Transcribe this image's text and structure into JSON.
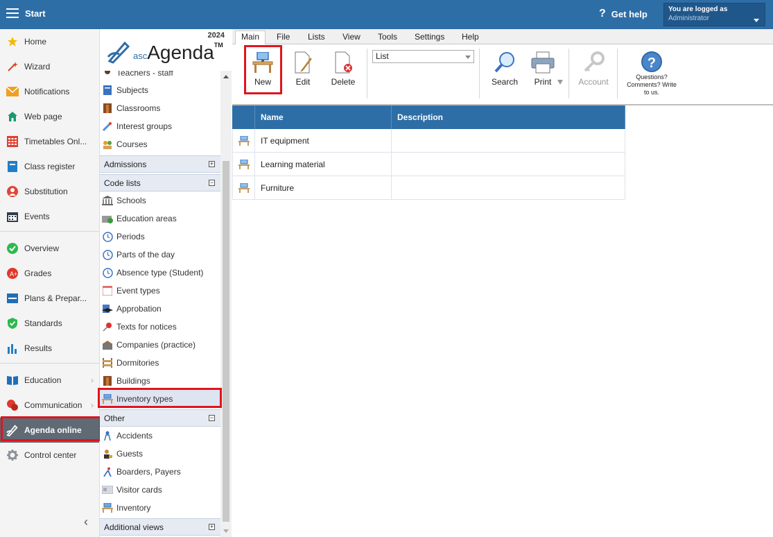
{
  "topbar": {
    "title": "Start",
    "help_label": "Get help",
    "help_glyph": "?",
    "login_line1": "You are logged as",
    "login_line2": "Administrator"
  },
  "leftnav": {
    "items": [
      {
        "label": "Home",
        "icon": "star-icon"
      },
      {
        "label": "Wizard",
        "icon": "wand-icon"
      },
      {
        "label": "Notifications",
        "icon": "envelope-icon"
      },
      {
        "label": "Web page",
        "icon": "house-icon"
      },
      {
        "label": "Timetables Onl...",
        "icon": "calendar-grid-icon"
      },
      {
        "label": "Class register",
        "icon": "book-icon"
      },
      {
        "label": "Substitution",
        "icon": "person-icon"
      },
      {
        "label": "Events",
        "icon": "event-calendar-icon"
      },
      {
        "label": "Overview",
        "icon": "check-circle-icon"
      },
      {
        "label": "Grades",
        "icon": "grades-icon"
      },
      {
        "label": "Plans & Prepar...",
        "icon": "plans-icon"
      },
      {
        "label": "Standards",
        "icon": "shield-check-icon"
      },
      {
        "label": "Results",
        "icon": "bar-chart-icon"
      },
      {
        "label": "Education",
        "icon": "open-book-icon"
      },
      {
        "label": "Communication",
        "icon": "chat-icon"
      },
      {
        "label": "Agenda online",
        "icon": "agenda-logo-icon"
      },
      {
        "label": "Control center",
        "icon": "gear-icon"
      }
    ],
    "active_item": "Agenda online"
  },
  "secpanel": {
    "year": "2024",
    "logo_asc": "asc",
    "logo_agenda": "Agenda",
    "logo_tm": "TM",
    "items_top": [
      "Teachers - staff",
      "Subjects",
      "Classrooms",
      "Interest groups",
      "Courses"
    ],
    "section_admissions": "Admissions",
    "section_codelists": "Code lists",
    "items_codelists": [
      "Schools",
      "Education areas",
      "Periods",
      "Parts of the day",
      "Absence type (Student)",
      "Event types",
      "Approbation",
      "Texts for notices",
      "Companies (practice)",
      "Dormitories",
      "Buildings",
      "Inventory types"
    ],
    "selected_item": "Inventory types",
    "section_other": "Other",
    "items_other": [
      "Accidents",
      "Guests",
      "Boarders, Payers",
      "Visitor cards",
      "Inventory"
    ],
    "section_additional": "Additional views",
    "plus": "+",
    "minus": "−"
  },
  "menubar": {
    "tabs": [
      "Main",
      "File",
      "Lists",
      "View",
      "Tools",
      "Settings",
      "Help"
    ],
    "active_tab": "Main"
  },
  "ribbon": {
    "new": "New",
    "edit": "Edit",
    "delete": "Delete",
    "select_value": "List",
    "search": "Search",
    "print": "Print",
    "account": "Account",
    "questions": "Questions? Comments? Write to us."
  },
  "table": {
    "columns": [
      "Name",
      "Description"
    ],
    "rows": [
      {
        "name": "IT equipment",
        "description": ""
      },
      {
        "name": "Learning material",
        "description": ""
      },
      {
        "name": "Furniture",
        "description": ""
      }
    ]
  },
  "colors": {
    "brand": "#2e6ea6",
    "highlight": "#e0141e",
    "active_nav": "#5f6a75"
  }
}
